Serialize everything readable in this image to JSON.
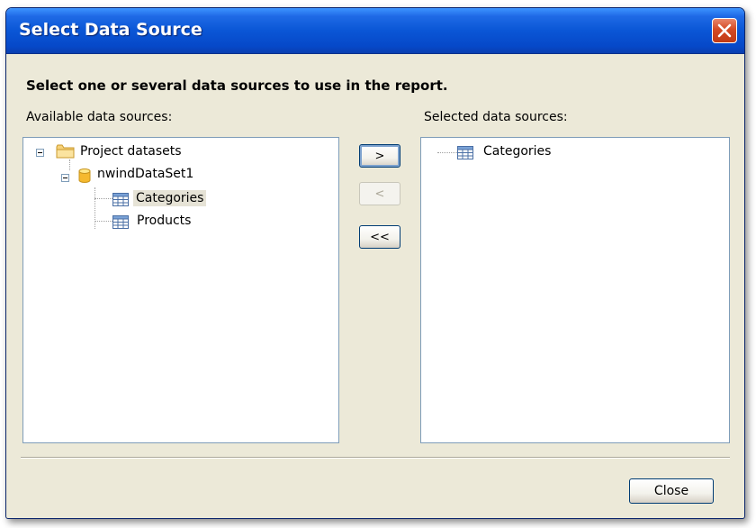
{
  "window": {
    "title": "Select Data Source"
  },
  "instruction": "Select one or several data sources to use in the report.",
  "available": {
    "label": "Available data sources:",
    "tree": {
      "root": "Project datasets",
      "dataset": "nwindDataSet1",
      "tables": [
        "Categories",
        "Products"
      ]
    }
  },
  "buttons": {
    "add": ">",
    "remove": "<",
    "remove_all": "<<",
    "close": "Close"
  },
  "selected": {
    "label": "Selected data sources:",
    "items": [
      "Categories"
    ]
  }
}
